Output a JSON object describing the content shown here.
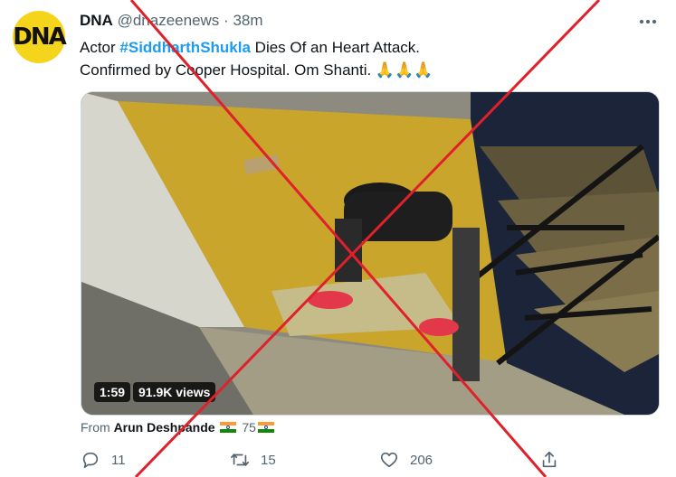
{
  "author": {
    "avatar_text": "DNA",
    "name": "DNA",
    "handle": "@dnazeenews",
    "separator": "·",
    "time": "38m"
  },
  "tweet": {
    "line1_prefix": "Actor ",
    "hashtag": "#SiddharthShukla",
    "line1_suffix": " Dies Of an Heart Attack.",
    "line2": "Confirmed by Cooper Hospital. Om Shanti. 🙏🙏🙏"
  },
  "video": {
    "duration": "1:59",
    "views": "91.9K views"
  },
  "from": {
    "prefix": "From ",
    "user": "Arun Deshpande",
    "suffix": "75"
  },
  "actions": {
    "reply_count": "11",
    "retweet_count": "15",
    "like_count": "206"
  },
  "colors": {
    "accent": "#1d9bf0",
    "avatar_bg": "#f5d51c",
    "cross": "#e0202a"
  }
}
